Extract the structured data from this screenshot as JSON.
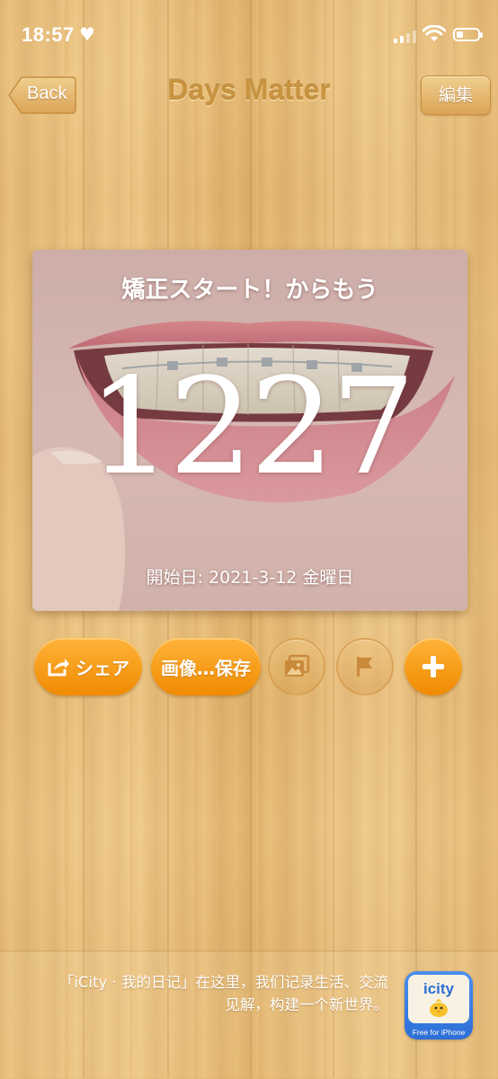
{
  "status_bar": {
    "time": "18:57",
    "heart_icon": "heart-icon"
  },
  "nav": {
    "back_label": "Back",
    "title": "Days Matter",
    "edit_label": "編集"
  },
  "card": {
    "caption": "矯正スタート！からもう",
    "days": "1227",
    "start_date": "開始日: 2021-3-12 金曜日"
  },
  "actions": {
    "share_label": "シェア",
    "save_label": "画像…保存",
    "image_icon": "image-icon",
    "flag_icon": "flag-icon",
    "add_icon": "plus-icon"
  },
  "ad": {
    "line1": "「iCity · 我的日记」在这里，我们记录生活、交流",
    "line2": "见解，构建一个新世界。",
    "icon_brand": "icity",
    "icon_sub": "Free for iPhone"
  },
  "colors": {
    "accent_orange": "#f5960d",
    "title_brown": "#c8933f"
  }
}
